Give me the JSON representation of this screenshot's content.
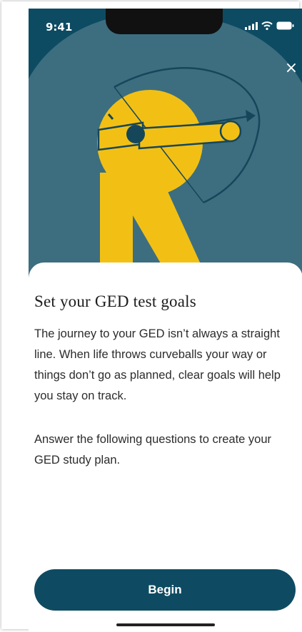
{
  "status_bar": {
    "time": "9:41"
  },
  "close": {
    "label": "×",
    "icon": "close-icon"
  },
  "content": {
    "title": "Set your GED test goals",
    "paragraph_1": "The journey to your GED isn’t always a straight line. When life throws curveballs your way or things don’t go as planned, clear goals will help you stay on track.",
    "paragraph_2": "Answer the following questions to create your GED study plan."
  },
  "cta": {
    "begin_label": "Begin"
  },
  "colors": {
    "brand_dark_teal": "#0d4b62",
    "mid_teal": "#3c6e80",
    "illustration_yellow": "#f2c014",
    "text_primary": "#1d1d1d"
  }
}
